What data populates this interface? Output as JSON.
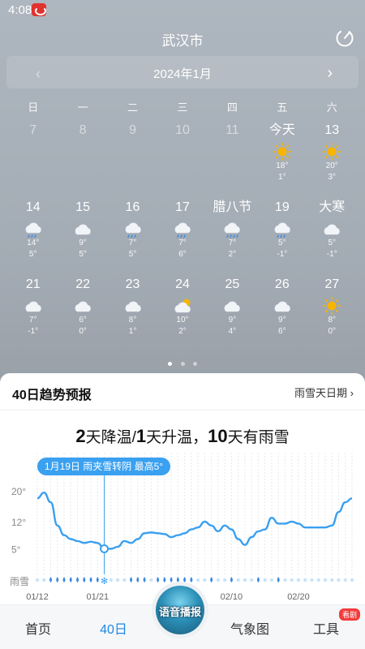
{
  "status": {
    "time": "4:08"
  },
  "header": {
    "city": "武汉市"
  },
  "month_bar": {
    "label": "2024年1月",
    "prev_icon": "chevron-left-icon",
    "next_icon": "chevron-right-icon"
  },
  "weekdays": [
    "日",
    "一",
    "二",
    "三",
    "四",
    "五",
    "六"
  ],
  "calendar": {
    "rows": [
      [
        {
          "day": "7",
          "past": true
        },
        {
          "day": "8",
          "past": true
        },
        {
          "day": "9",
          "past": true
        },
        {
          "day": "10",
          "past": true
        },
        {
          "day": "11",
          "past": true
        },
        {
          "day": "今天",
          "icon": "sun",
          "high": "18°",
          "low": "1°"
        },
        {
          "day": "13",
          "icon": "sun",
          "high": "20°",
          "low": "3°"
        }
      ],
      [
        {
          "day": "14",
          "icon": "rain",
          "high": "14°",
          "low": "5°"
        },
        {
          "day": "15",
          "icon": "cloud",
          "high": "9°",
          "low": "5°"
        },
        {
          "day": "16",
          "icon": "rain",
          "high": "7°",
          "low": "5°"
        },
        {
          "day": "17",
          "icon": "rain",
          "high": "7°",
          "low": "6°"
        },
        {
          "day": "腊八节",
          "icon": "heavy-rain",
          "high": "7°",
          "low": "2°"
        },
        {
          "day": "19",
          "icon": "rain",
          "high": "5°",
          "low": "-1°"
        },
        {
          "day": "大寒",
          "icon": "cloud",
          "high": "5°",
          "low": "-1°"
        }
      ],
      [
        {
          "day": "21",
          "icon": "cloud",
          "high": "7°",
          "low": "-1°"
        },
        {
          "day": "22",
          "icon": "cloud",
          "high": "6°",
          "low": "0°"
        },
        {
          "day": "23",
          "icon": "cloud",
          "high": "8°",
          "low": "1°"
        },
        {
          "day": "24",
          "icon": "partly-cloudy",
          "high": "10°",
          "low": "2°"
        },
        {
          "day": "25",
          "icon": "cloud",
          "high": "9°",
          "low": "4°"
        },
        {
          "day": "26",
          "icon": "cloud",
          "high": "9°",
          "low": "6°"
        },
        {
          "day": "27",
          "icon": "sun",
          "high": "8°",
          "low": "0°"
        }
      ]
    ]
  },
  "panel": {
    "title": "40日趋势预报",
    "link": "雨雪天日期 ›",
    "summary": {
      "n1": "2",
      "t1": "天降温/",
      "n2": "1",
      "t2": "天升温，",
      "n3": "10",
      "t3": "天有雨雪"
    }
  },
  "colors": {
    "accent": "#1e88e5",
    "line": "#3aa0f0",
    "badge": "#f23b3b",
    "sun": "#f7b500"
  },
  "chart_data": {
    "type": "line",
    "title": "",
    "xlabel": "",
    "ylabel": "",
    "y_ticks": [
      "20°",
      "12°",
      "5°"
    ],
    "ylim": [
      0,
      24
    ],
    "x_tick_labels": [
      "01/12",
      "01/21",
      "02/10",
      "02/20"
    ],
    "start_date": "01/12",
    "series": [
      {
        "values": [
          18,
          19.5,
          17,
          11,
          8.5,
          7.5,
          7,
          6.5,
          6.8,
          6.5,
          5,
          5,
          5.5,
          7,
          6.5,
          7.5,
          9,
          9.2,
          9,
          8.8,
          8,
          8.5,
          9,
          10,
          10.5,
          12,
          11,
          9.5,
          11,
          10,
          7.5,
          6,
          8,
          9.5,
          10,
          13,
          11.5,
          11.5,
          12,
          11.5,
          10.5,
          10.5,
          10.5,
          10.5,
          11,
          14.5,
          17,
          18
        ]
      }
    ],
    "precip_label": "雨雪",
    "tooltip": "1月19日 雨夹雪转阴 最高5°",
    "highlight_index": 10
  },
  "nav": {
    "items": [
      {
        "label": "首页",
        "active": false
      },
      {
        "label": "40日",
        "active": true
      },
      {
        "label": "气象图",
        "active": false
      },
      {
        "label": "工具",
        "active": false,
        "badge": "看剧"
      }
    ],
    "voice": "语音播报"
  }
}
